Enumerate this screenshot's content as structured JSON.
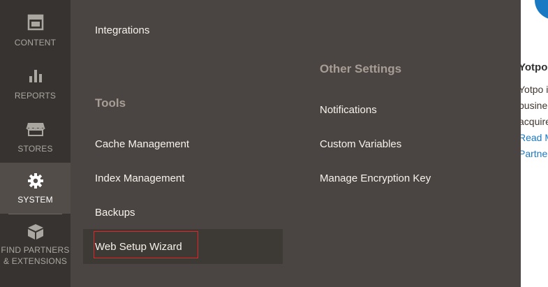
{
  "sidebar": {
    "items": [
      {
        "label": "CONTENT",
        "icon": "content-icon"
      },
      {
        "label": "REPORTS",
        "icon": "reports-icon"
      },
      {
        "label": "STORES",
        "icon": "stores-icon"
      },
      {
        "label": "SYSTEM",
        "icon": "gear-icon",
        "active": true
      },
      {
        "label": "FIND PARTNERS",
        "label2": "& EXTENSIONS",
        "icon": "partners-icon"
      }
    ]
  },
  "flyout": {
    "top_link": "Integrations",
    "tools": {
      "title": "Tools",
      "items": [
        "Cache Management",
        "Index Management",
        "Backups",
        "Web Setup Wizard"
      ]
    },
    "other_settings": {
      "title": "Other Settings",
      "items": [
        "Notifications",
        "Custom Variables",
        "Manage Encryption Key"
      ]
    }
  },
  "content": {
    "title": "Yotpo",
    "lines": [
      "Yotpo i",
      "busine",
      "acquire"
    ],
    "links": [
      "Read M",
      "Partne"
    ]
  },
  "colors": {
    "sidebar_bg": "#373330",
    "flyout_bg": "#4a4542",
    "active_bg": "#524d49",
    "link": "#1979c3",
    "focus_border": "#e22626"
  }
}
